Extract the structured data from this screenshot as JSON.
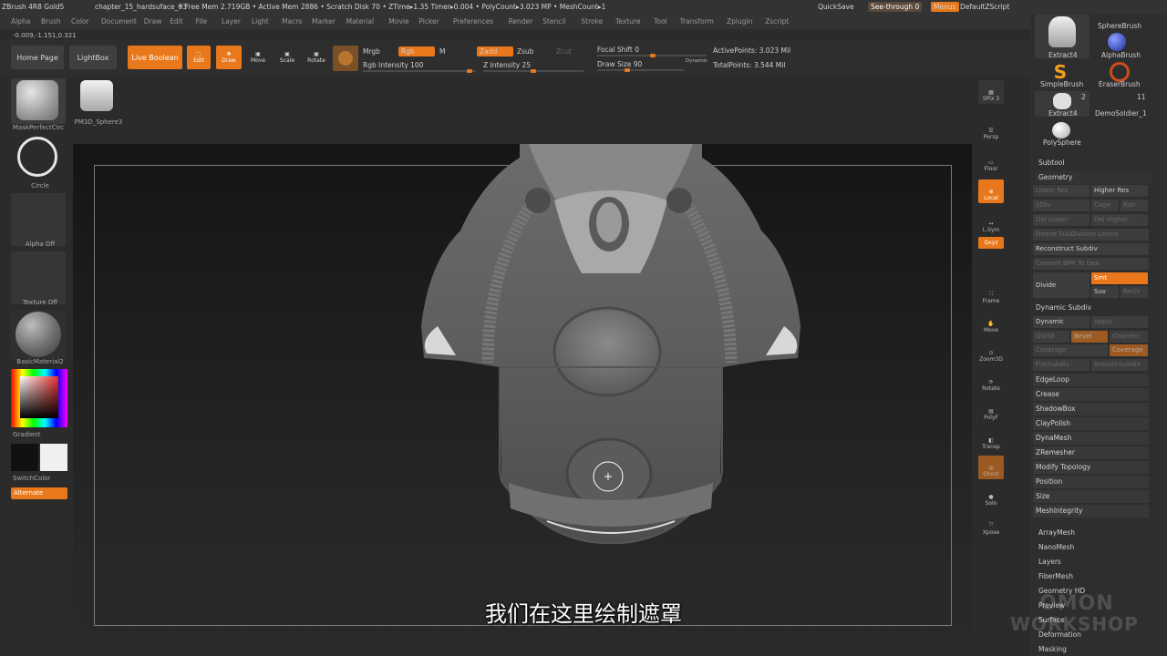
{
  "titlebar": {
    "app": "ZBrush 4R8 Gold5",
    "doc": "chapter_15_hardsuface_03",
    "stats": "• Free Mem 2.719GB • Active Mem 2886 • Scratch Disk 70 • ZTime▸1.35 Timer▸0.004 • PolyCount▸3.023 MP • MeshCount▸1",
    "quicksave": "QuickSave",
    "seethrough": "See-through 0",
    "menus": "Menus",
    "script": "DefaultZScript"
  },
  "menu": [
    "Alpha",
    "Brush",
    "Color",
    "Document",
    "Draw",
    "Edit",
    "File",
    "Layer",
    "Light",
    "Macro",
    "Marker",
    "Material",
    "Movie",
    "Picker",
    "Preferences",
    "Render",
    "Stencil",
    "Stroke",
    "Texture",
    "Tool",
    "Transform",
    "Zplugin",
    "Zscript"
  ],
  "coords": "-0.009,-1.151,0.321",
  "toolbar": {
    "home": "Home Page",
    "lightbox": "LightBox",
    "liveboolean": "Live Boolean",
    "edit": "Edit",
    "draw": "Draw",
    "move": "Move",
    "scale": "Scale",
    "rotate": "Rotate",
    "mrgb": "Mrgb",
    "rgb": "Rgb",
    "m": "M",
    "rgb_intensity": "Rgb Intensity 100",
    "zadd": "Zadd",
    "zsub": "Zsub",
    "zcut": "Zcut",
    "z_intensity": "Z Intensity 25",
    "focal_shift": "Focal Shift 0",
    "draw_size": "Draw Size 90",
    "dynamic": "Dynamic",
    "active_points": "ActivePoints: 3.023 Mil",
    "total_points": "TotalPoints: 3.544 Mil"
  },
  "left_shelf": {
    "brush": "MaskPerfectCirc",
    "stroke": "Circle",
    "alpha": "Alpha Off",
    "texture": "Texture Off",
    "material": "BasicMaterial2",
    "gradient": "Gradient",
    "switchcolor": "SwitchColor",
    "alternate": "Alternate",
    "tool_thumb": "PM3D_Sphere3"
  },
  "right_tools": [
    {
      "label": "SPix 3"
    },
    {
      "label": "Persp"
    },
    {
      "label": "Floor"
    },
    {
      "label": "Local"
    },
    {
      "label": "L.Sym"
    },
    {
      "label": "Qxyz"
    },
    {
      "label": "Frame"
    },
    {
      "label": "Move"
    },
    {
      "label": "Zoom3D"
    },
    {
      "label": "Rotate"
    },
    {
      "label": "PolyF"
    },
    {
      "label": "Transp"
    },
    {
      "label": "Ghost"
    },
    {
      "label": "Solo"
    },
    {
      "label": "Xpose"
    }
  ],
  "tool_palette": {
    "items": [
      {
        "name": "Extract4"
      },
      {
        "name": "SphereBrush"
      },
      {
        "name": "AlphaBrush"
      },
      {
        "name": "SimpleBrush"
      },
      {
        "name": "EraserBrush"
      },
      {
        "name": "Extract4",
        "count": "2"
      },
      {
        "name": "DemoSoldier_1",
        "count": "11"
      },
      {
        "name": "PolySphere"
      }
    ],
    "subtool": "Subtool",
    "geometry": "Geometry",
    "lower_res": "Lower Res",
    "higher_res": "Higher Res",
    "sdiv": "SDiv",
    "cage": "Cage",
    "rstr": "Rstr",
    "del_lower": "Del Lower",
    "del_higher": "Del Higher",
    "freeze": "Freeze SubDivision Levels",
    "reconstruct": "Reconstruct Subdiv",
    "convert_bpr": "Convert BPR To Geo",
    "divide": "Divide",
    "smt": "Smt",
    "suv": "Suv",
    "reuv": "ReUV",
    "dynamic_subdiv": "Dynamic Subdiv",
    "dynamic": "Dynamic",
    "apply": "Apply",
    "qgrid": "QGrid",
    "bevel": "Bevel",
    "chamfer": "Chamfer",
    "coverage": "Coverage",
    "coverage2": "Coverage",
    "flatsubdiv": "FlatSubdiv",
    "smoothsubdiv": "SmoothSubdiv",
    "sections": [
      "EdgeLoop",
      "Crease",
      "ShadowBox",
      "ClayPolish",
      "DynaMesh",
      "ZRemesher",
      "Modify Topology",
      "Position",
      "Size",
      "MeshIntegrity"
    ],
    "more": [
      "ArrayMesh",
      "NanoMesh",
      "Layers",
      "FiberMesh",
      "Geometry HD",
      "Preview",
      "Surface",
      "Deformation",
      "Masking"
    ]
  },
  "subtitle": "我们在这里绘制遮罩",
  "watermark": [
    "OMON",
    "WORKSHOP"
  ],
  "colors": {
    "accent": "#e8781b",
    "panel": "#2e2e2e"
  }
}
